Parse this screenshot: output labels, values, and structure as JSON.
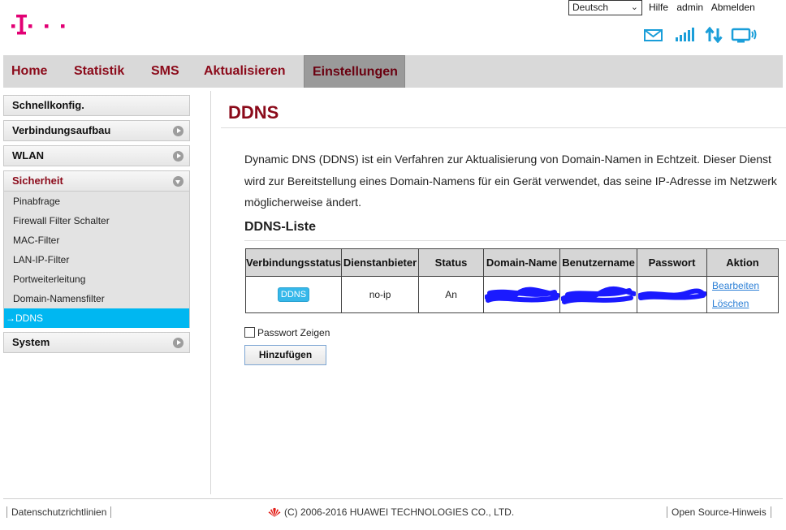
{
  "header": {
    "language": "Deutsch",
    "links": [
      "Hilfe",
      "admin",
      "Abmelden"
    ]
  },
  "nav": {
    "items": [
      "Home",
      "Statistik",
      "SMS",
      "Aktualisieren",
      "Einstellungen"
    ],
    "active": "Einstellungen"
  },
  "sidebar": {
    "groups": [
      "Schnellkonfig.",
      "Verbindungsaufbau",
      "WLAN",
      "Sicherheit",
      "System"
    ],
    "security_items": [
      "Pinabfrage",
      "Firewall Filter Schalter",
      "MAC-Filter",
      "LAN-IP-Filter",
      "Portweiterleitung",
      "Domain-Namensfilter",
      "DDNS"
    ],
    "active_item": "DDNS"
  },
  "main": {
    "title": "DDNS",
    "description": [
      "Dynamic DNS (DDNS) ist ein Verfahren zur Aktualisierung von Domain-Namen in Echtzeit. Dieser Dienst",
      "wird zur Bereitstellung eines Domain-Namens für ein Gerät verwendet, das seine IP-Adresse im Netzwerk",
      "möglicherweise ändert."
    ],
    "list_title": "DDNS-Liste",
    "table": {
      "headers": [
        "Verbindungsstatus",
        "Dienstanbieter",
        "Status",
        "Domain-Name",
        "Benutzername",
        "Passwort",
        "Aktion"
      ],
      "row": {
        "connection_badge": "DDNS",
        "provider": "no-ip",
        "status": "An",
        "action_edit": "Bearbeiten",
        "action_delete": "Löschen"
      }
    },
    "show_password": "Passwort Zeigen",
    "add_button": "Hinzufügen"
  },
  "footer": {
    "privacy": "Datenschutzrichtlinien",
    "copyright": "(C) 2006-2016 HUAWEI TECHNOLOGIES CO., LTD.",
    "open_source": "Open Source-Hinweis"
  },
  "colors": {
    "brand_magenta": "#e20074",
    "title_red": "#8b0a1a",
    "active_blue": "#00b7f1",
    "icon_blue": "#1a9ed9",
    "redaction_blue": "#1a1aff"
  }
}
